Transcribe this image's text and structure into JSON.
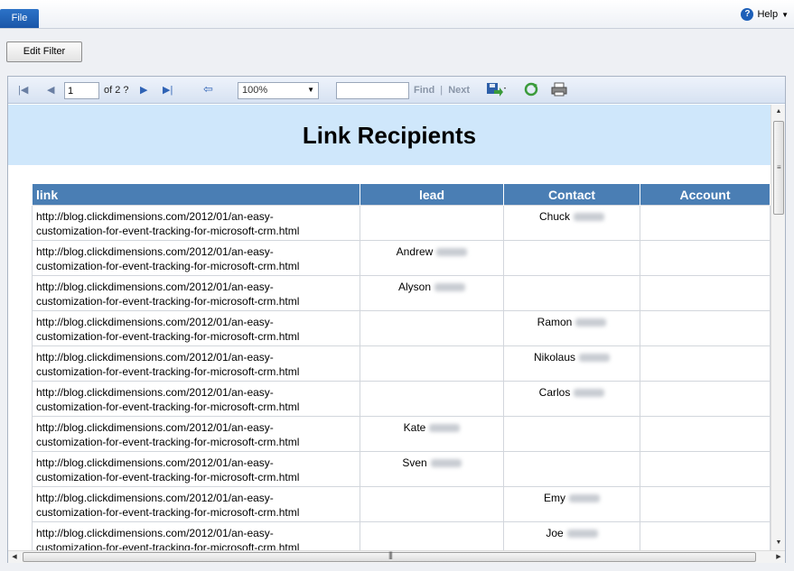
{
  "menubar": {
    "file_label": "File",
    "help_label": "Help"
  },
  "filter": {
    "edit_filter_label": "Edit Filter"
  },
  "toolbar": {
    "page_value": "1",
    "page_of": "of 2 ?",
    "zoom_value": "100%",
    "find_label": "Find",
    "separator": "|",
    "next_label": "Next",
    "find_value": ""
  },
  "report": {
    "title": "Link Recipients",
    "columns": {
      "link": "link",
      "lead": "lead",
      "contact": "Contact",
      "account": "Account"
    },
    "rows": [
      {
        "link_line1": "http://blog.clickdimensions.com/2012/01/an-easy-",
        "link_line2": "customization-for-event-tracking-for-microsoft-crm.html",
        "lead": "",
        "contact": "Chuck",
        "account": ""
      },
      {
        "link_line1": "http://blog.clickdimensions.com/2012/01/an-easy-",
        "link_line2": "customization-for-event-tracking-for-microsoft-crm.html",
        "lead": "Andrew",
        "contact": "",
        "account": ""
      },
      {
        "link_line1": "http://blog.clickdimensions.com/2012/01/an-easy-",
        "link_line2": "customization-for-event-tracking-for-microsoft-crm.html",
        "lead": "Alyson",
        "contact": "",
        "account": ""
      },
      {
        "link_line1": "http://blog.clickdimensions.com/2012/01/an-easy-",
        "link_line2": "customization-for-event-tracking-for-microsoft-crm.html",
        "lead": "",
        "contact": "Ramon",
        "account": ""
      },
      {
        "link_line1": "http://blog.clickdimensions.com/2012/01/an-easy-",
        "link_line2": "customization-for-event-tracking-for-microsoft-crm.html",
        "lead": "",
        "contact": "Nikolaus",
        "account": ""
      },
      {
        "link_line1": "http://blog.clickdimensions.com/2012/01/an-easy-",
        "link_line2": "customization-for-event-tracking-for-microsoft-crm.html",
        "lead": "",
        "contact": "Carlos",
        "account": ""
      },
      {
        "link_line1": "http://blog.clickdimensions.com/2012/01/an-easy-",
        "link_line2": "customization-for-event-tracking-for-microsoft-crm.html",
        "lead": "Kate",
        "contact": "",
        "account": ""
      },
      {
        "link_line1": "http://blog.clickdimensions.com/2012/01/an-easy-",
        "link_line2": "customization-for-event-tracking-for-microsoft-crm.html",
        "lead": "Sven",
        "contact": "",
        "account": ""
      },
      {
        "link_line1": "http://blog.clickdimensions.com/2012/01/an-easy-",
        "link_line2": "customization-for-event-tracking-for-microsoft-crm.html",
        "lead": "",
        "contact": "Emy",
        "account": ""
      },
      {
        "link_line1": "http://blog.clickdimensions.com/2012/01/an-easy-",
        "link_line2": "customization-for-event-tracking-for-microsoft-crm.html",
        "lead": "",
        "contact": "Joe",
        "account": ""
      }
    ]
  },
  "colors": {
    "header_fill": "#4a7eb4",
    "title_band": "#cfe7fb",
    "file_button": "#1f5fb4"
  },
  "icons": [
    "first-page-icon",
    "previous-page-icon",
    "next-page-icon",
    "last-page-icon",
    "back-icon",
    "export-icon",
    "refresh-icon",
    "print-icon",
    "help-icon"
  ]
}
